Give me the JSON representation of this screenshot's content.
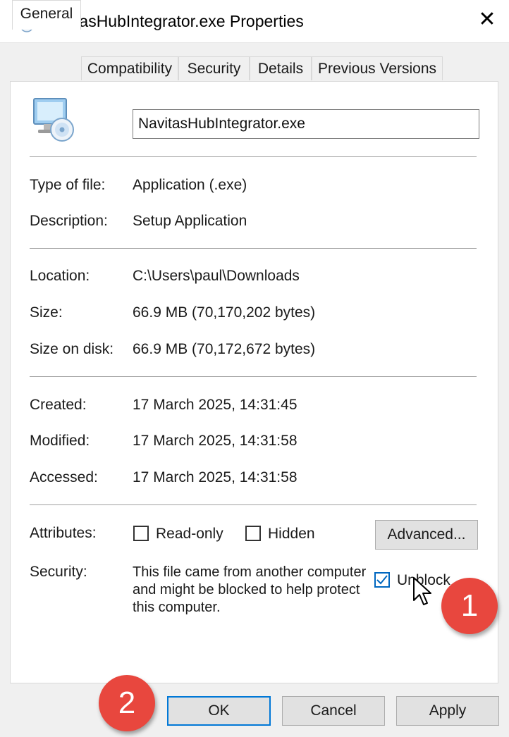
{
  "window": {
    "title": "NavitasHubIntegrator.exe Properties",
    "close_glyph": "✕"
  },
  "tabs": [
    {
      "label": "General",
      "active": true
    },
    {
      "label": "Compatibility"
    },
    {
      "label": "Security"
    },
    {
      "label": "Details"
    },
    {
      "label": "Previous Versions"
    }
  ],
  "general": {
    "file_name": "NavitasHubIntegrator.exe",
    "type_label": "Type of file:",
    "type_value": "Application (.exe)",
    "description_label": "Description:",
    "description_value": "Setup Application",
    "location_label": "Location:",
    "location_value": "C:\\Users\\paul\\Downloads",
    "size_label": "Size:",
    "size_value": "66.9 MB (70,170,202 bytes)",
    "size_on_disk_label": "Size on disk:",
    "size_on_disk_value": "66.9 MB (70,172,672 bytes)",
    "created_label": "Created:",
    "created_value": "17 March 2025, 14:31:45",
    "modified_label": "Modified:",
    "modified_value": "17 March 2025, 14:31:58",
    "accessed_label": "Accessed:",
    "accessed_value": "17 March 2025, 14:31:58",
    "attributes_label": "Attributes:",
    "readonly_label": "Read-only",
    "readonly_checked": false,
    "hidden_label": "Hidden",
    "hidden_checked": false,
    "advanced_label": "Advanced...",
    "security_label": "Security:",
    "security_text": "This file came from another computer and might be blocked to help protect this computer.",
    "unblock_label": "Unblock",
    "unblock_checked": true
  },
  "buttons": {
    "ok": "OK",
    "cancel": "Cancel",
    "apply": "Apply"
  },
  "annotations": {
    "badge_1": "1",
    "badge_2": "2",
    "color": "#e8473e"
  },
  "colors": {
    "accent": "#0078d7",
    "checkmark": "#0067c0"
  }
}
